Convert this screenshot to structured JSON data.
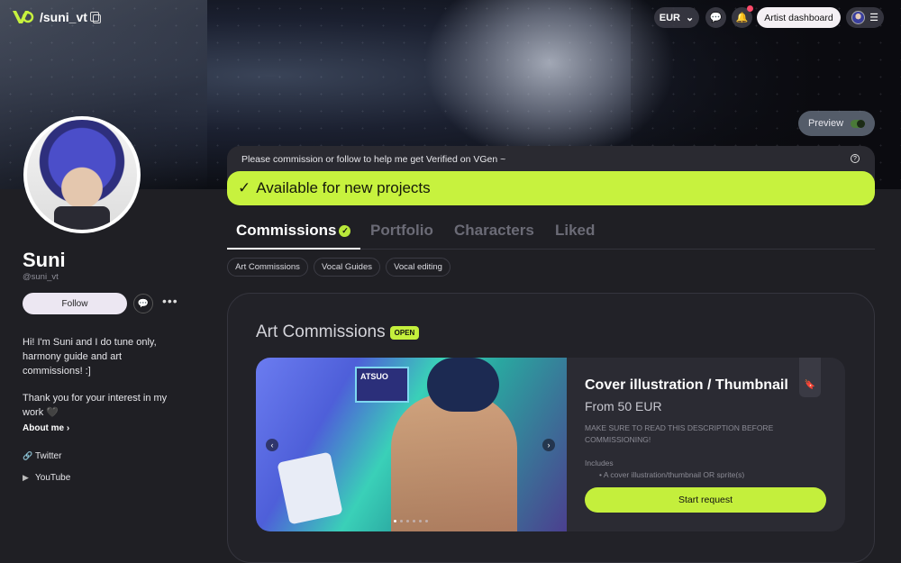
{
  "header": {
    "handle": "/suni_vt",
    "currency": "EUR",
    "artist_dashboard": "Artist dashboard",
    "preview_label": "Preview"
  },
  "profile": {
    "name": "Suni",
    "username": "@suni_vt",
    "follow_label": "Follow",
    "more_label": "•••",
    "bio_line1": "Hi! I'm Suni and I do tune only, harmony guide and art commissions! :]",
    "bio_line2": "Thank you for your interest in my work 🖤",
    "about_me": "About me ›",
    "socials": [
      {
        "label": "Twitter",
        "icon": "link-icon"
      },
      {
        "label": "YouTube",
        "icon": "youtube-icon"
      }
    ]
  },
  "notice": {
    "text": "Please commission or follow to help me get Verified on VGen ~",
    "available": "Available for new projects"
  },
  "tabs": [
    {
      "label": "Commissions",
      "active": true
    },
    {
      "label": "Portfolio",
      "active": false
    },
    {
      "label": "Characters",
      "active": false
    },
    {
      "label": "Liked",
      "active": false
    }
  ],
  "chips": [
    "Art Commissions",
    "Vocal Guides",
    "Vocal editing"
  ],
  "section": {
    "title": "Art Commissions",
    "badge": "OPEN"
  },
  "card": {
    "poster_text": "ATSUO",
    "title": "Cover illustration / Thumbnail",
    "price": "From 50 EUR",
    "description": "MAKE SURE TO READ THIS DESCRIPTION BEFORE COMMISSIONING!",
    "includes_label": "Includes",
    "includes_item": "•   A cover illustration/thumbnail OR sprite(s)",
    "start_request": "Start request",
    "slides": 6,
    "current_slide": 1
  },
  "colors": {
    "accent": "#c7f23e",
    "background": "#1f1f24",
    "notification": "#ff4a6a"
  }
}
